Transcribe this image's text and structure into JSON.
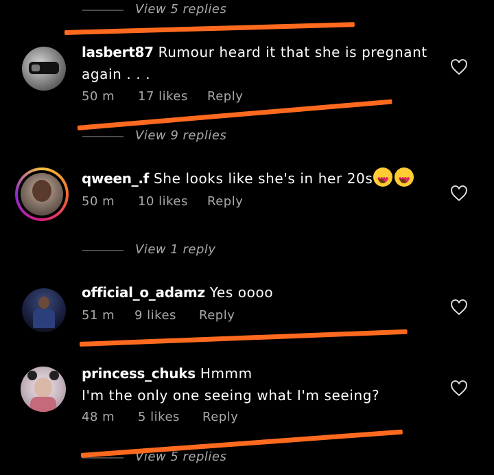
{
  "threads": {
    "top": {
      "view_replies": "View 5 replies"
    },
    "bottom": {
      "view_replies": "View 5 replies"
    }
  },
  "comments": [
    {
      "username": "lasbert87",
      "text": "Rumour heard it that she is pregnant again . . .",
      "time": "50 m",
      "likes": "17 likes",
      "reply_label": "Reply",
      "view_replies": "View 9 replies"
    },
    {
      "username": "qween_.f",
      "text": "She looks like she's in her 20s",
      "time": "50 m",
      "likes": "10 likes",
      "reply_label": "Reply",
      "view_replies": "View 1 reply"
    },
    {
      "username": "official_o_adamz",
      "text": "Yes oooo",
      "time": "51 m",
      "likes": "9 likes",
      "reply_label": "Reply"
    },
    {
      "username": "princess_chuks",
      "text": "Hmmm",
      "text_line2": "I'm the only one seeing what I'm seeing?",
      "time": "48 m",
      "likes": "5 likes",
      "reply_label": "Reply"
    }
  ],
  "icons": {
    "like": "heart-outline-icon",
    "emoji": "heart-eyes-emoji"
  },
  "colors": {
    "background": "#000000",
    "annotation_stroke": "#ff6a1f",
    "secondary_text": "#a8a8a8"
  }
}
